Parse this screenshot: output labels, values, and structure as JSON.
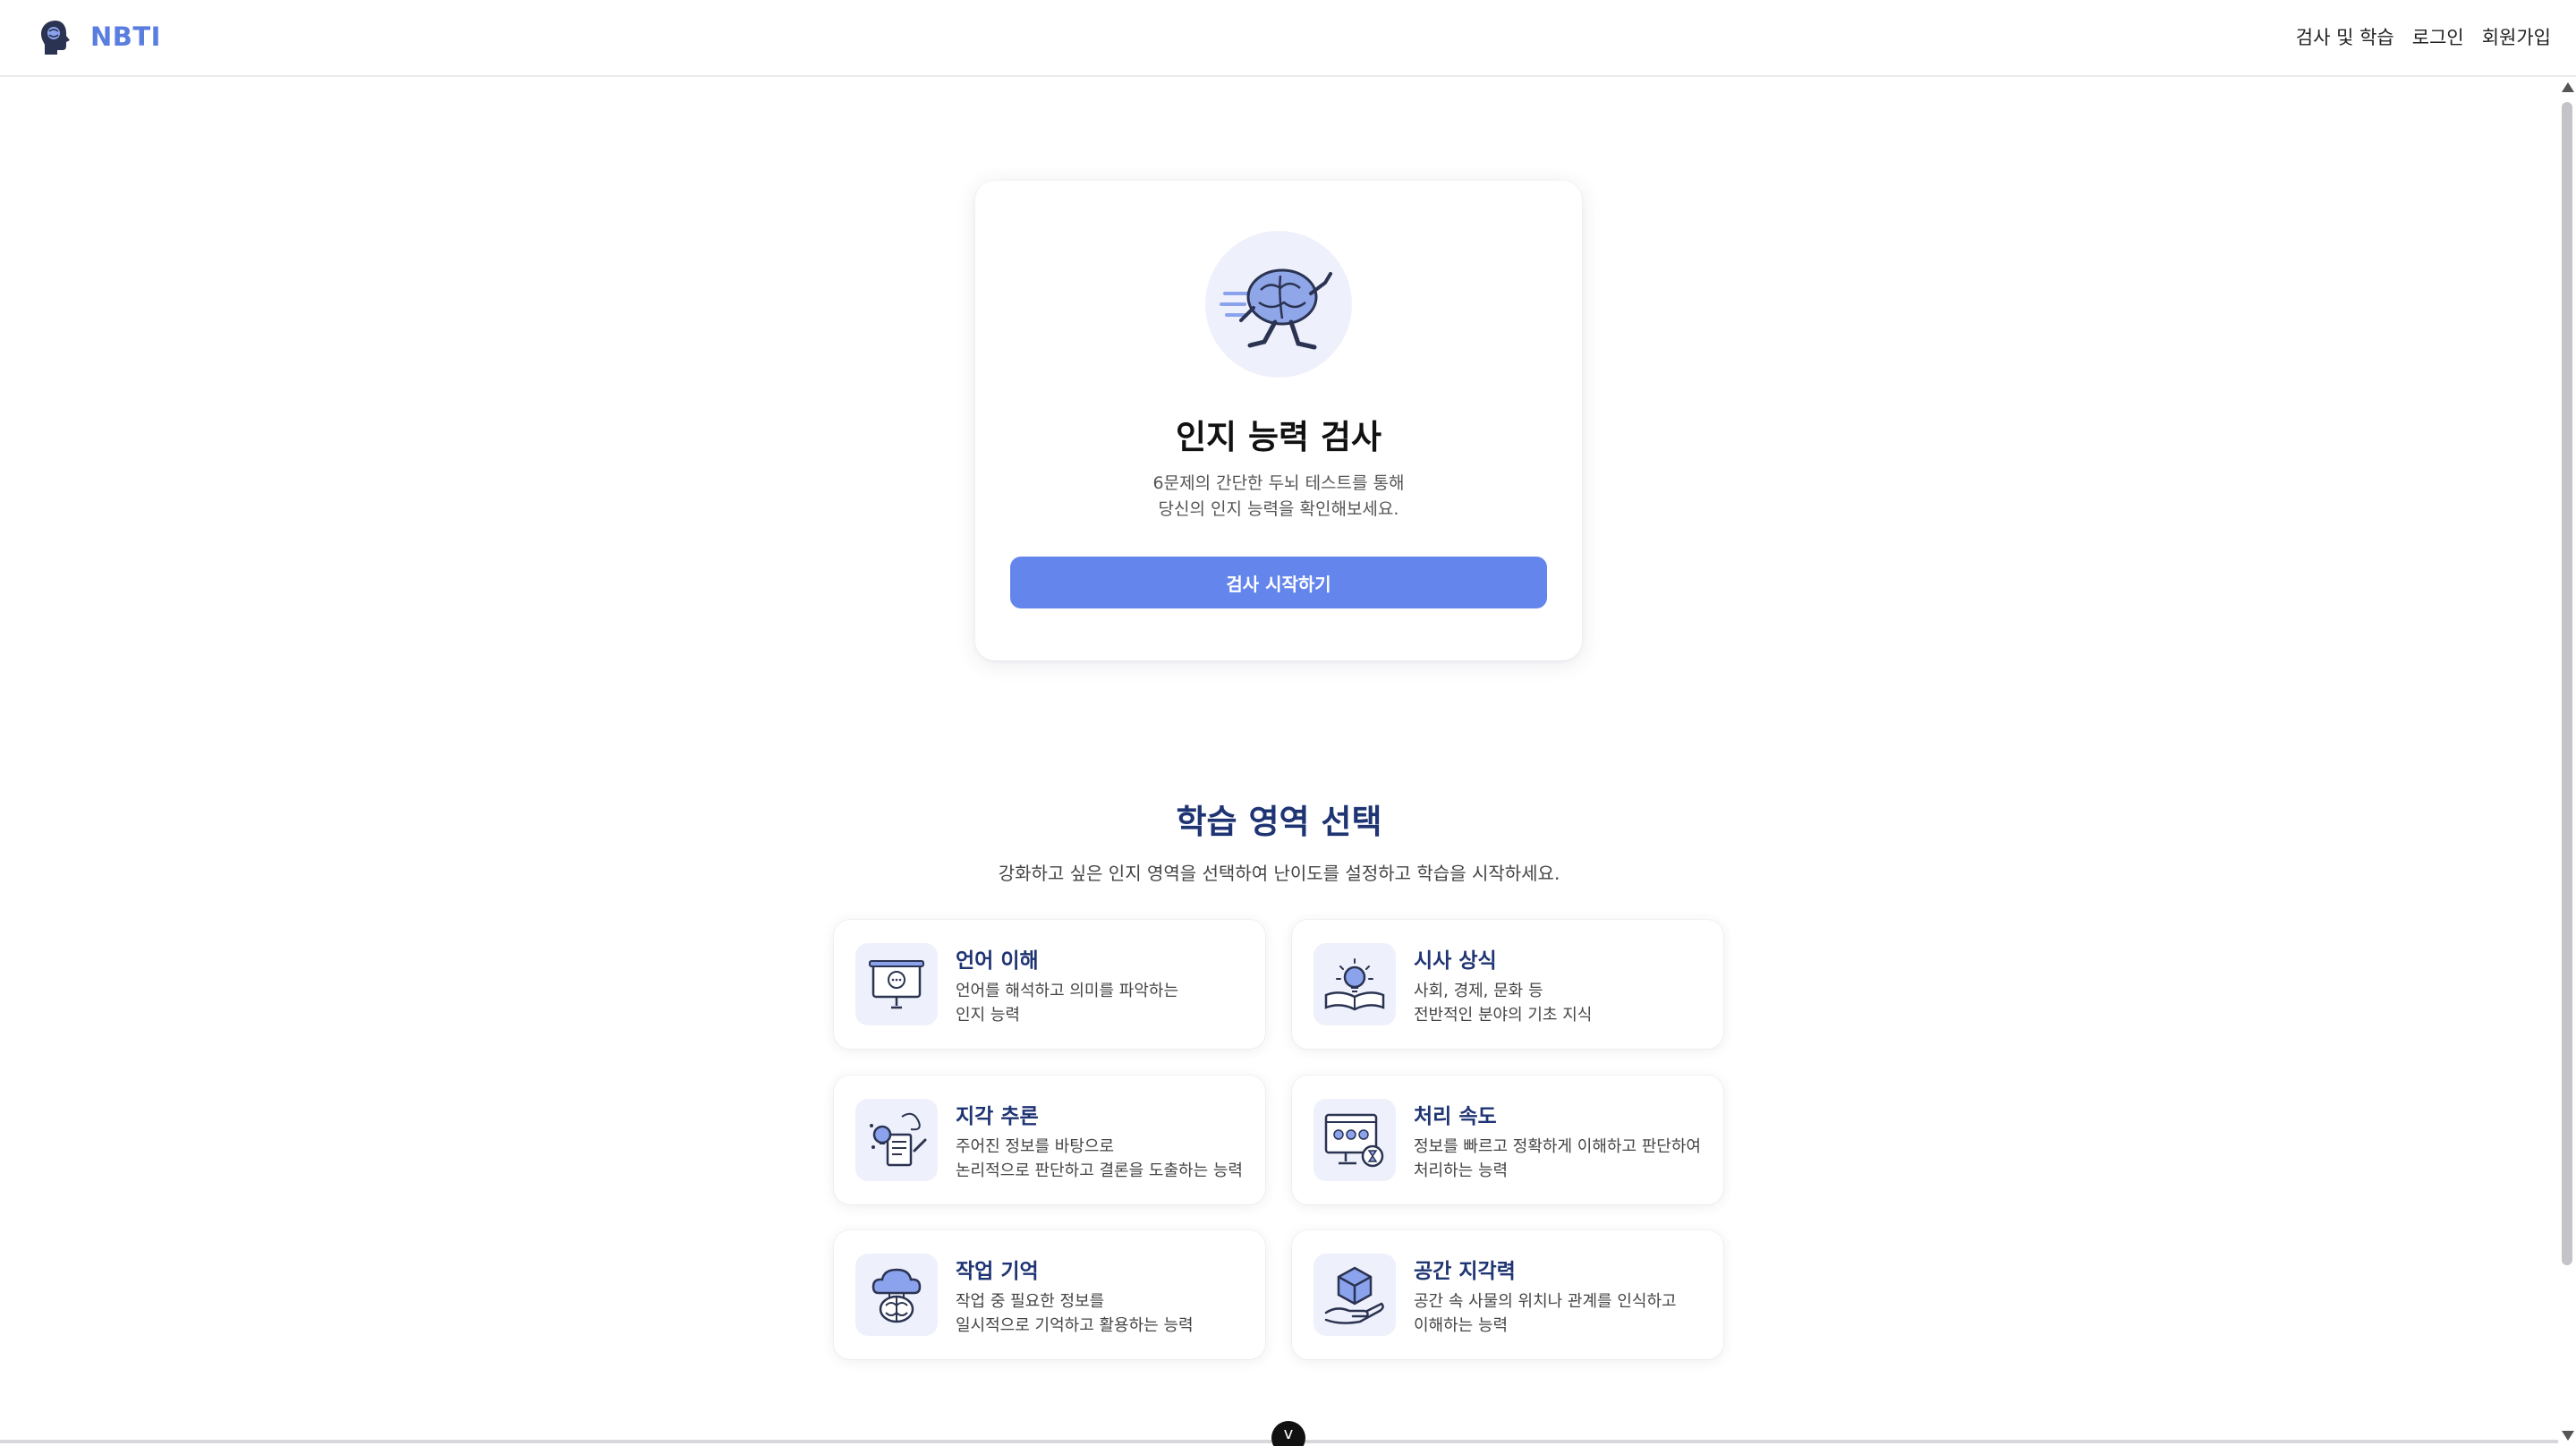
{
  "header": {
    "logo_text": "NBTI",
    "nav": [
      "검사 및 학습",
      "로그인",
      "회원가입"
    ]
  },
  "test_card": {
    "title": "인지 능력 검사",
    "desc_line1": "6문제의 간단한 두뇌 테스트를 통해",
    "desc_line2": "당신의 인지 능력을 확인해보세요.",
    "button": "검사 시작하기"
  },
  "learning": {
    "title": "학습 영역 선택",
    "subtitle": "강화하고 싶은 인지 영역을 선택하여 난이도를 설정하고 학습을 시작하세요.",
    "areas": [
      {
        "title": "언어 이해",
        "line1": "언어를 해석하고 의미를 파악하는",
        "line2": "인지 능력",
        "icon": "presentation-icon"
      },
      {
        "title": "시사 상식",
        "line1": "사회, 경제, 문화 등",
        "line2": "전반적인 분야의 기초 지식",
        "icon": "book-idea-icon"
      },
      {
        "title": "지각 추론",
        "line1": "주어진 정보를 바탕으로",
        "line2": "논리적으로 판단하고 결론을 도출하는 능력",
        "icon": "reasoning-icon"
      },
      {
        "title": "처리 속도",
        "line1": "정보를 빠르고 정확하게 이해하고 판단하여",
        "line2": "처리하는 능력",
        "icon": "monitor-timer-icon"
      },
      {
        "title": "작업 기억",
        "line1": "작업 중 필요한 정보를",
        "line2": "일시적으로 기억하고 활용하는 능력",
        "icon": "cloud-brain-icon"
      },
      {
        "title": "공간 지각력",
        "line1": "공간 속 사물의 위치나 관계를 인식하고",
        "line2": "이해하는 능력",
        "icon": "cube-hand-icon"
      }
    ]
  },
  "scroll_indicator": "v",
  "colors": {
    "brand": "#5a7ee0",
    "button": "#6486ec",
    "heading": "#1f3473",
    "icon_bg": "#eef1fb"
  }
}
